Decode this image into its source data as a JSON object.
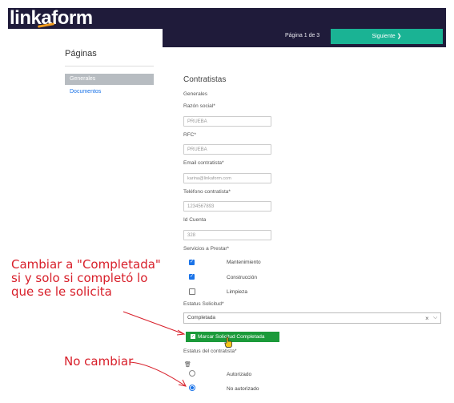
{
  "header": {
    "logo_text_a": "link",
    "logo_text_b": "a",
    "logo_text_c": "form",
    "page_indicator": "Página 1 de 3",
    "next_button": "Siguiente",
    "next_icon": "chevron-right-icon"
  },
  "sidebar": {
    "title": "Páginas",
    "items": [
      {
        "label": "Generales",
        "active": true
      },
      {
        "label": "Documentos",
        "active": false
      }
    ]
  },
  "form": {
    "title": "Contratistas",
    "section": "Generales",
    "fields": {
      "razon_label": "Razón social*",
      "razon_value": "PRUEBA",
      "rfc_label": "RFC*",
      "rfc_value": "PRUEBA",
      "email_label": "Email contratista*",
      "email_value": "karina@linkaform.com",
      "telefono_label": "Teléfono contratista*",
      "telefono_value": "1234567893",
      "cuenta_label": "Id Cuenta",
      "cuenta_value": "328"
    },
    "servicios_label": "Servicios a Prestar*",
    "servicios": [
      {
        "label": "Mantenimiento",
        "checked": true
      },
      {
        "label": "Construcción",
        "checked": true
      },
      {
        "label": "Limpieza",
        "checked": false
      }
    ],
    "estatus_solicitud_label": "Estatus Solicitud*",
    "estatus_solicitud_value": "Completada",
    "mark_button": "Marcar Solicitud Completada",
    "estatus_contratista_label": "Estatus del contratista*",
    "contratista_options": [
      {
        "label": "Autorizado",
        "selected": false
      },
      {
        "label": "No autorizado",
        "selected": true
      }
    ]
  },
  "annotations": {
    "note1_line1": "Cambiar a \"Completada\"",
    "note1_line2": "si y solo si completó lo",
    "note1_line3": "que se le solicita",
    "note2": "No cambiar",
    "color": "#d81f2a"
  },
  "colors": {
    "navbar": "#1f1b3a",
    "accent": "#1ab394",
    "button_green": "#1b9a3a",
    "link_blue": "#1a73e8",
    "logo_accent": "#f29b1d"
  }
}
